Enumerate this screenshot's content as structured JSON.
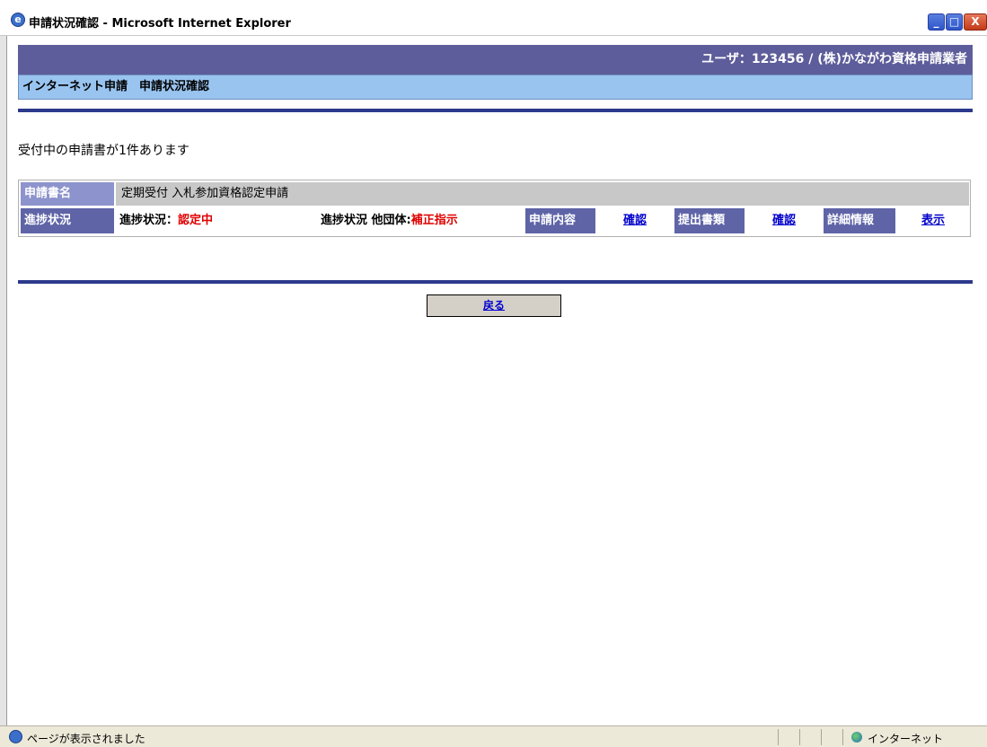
{
  "window": {
    "title": "申請状況確認 - Microsoft Internet Explorer",
    "minimize": "_",
    "maximize": "□",
    "close": "X"
  },
  "header": {
    "user_info": "ユーザ：123456 / (株)かながわ資格申請業者",
    "page_title": "インターネット申請　申請状況確認"
  },
  "main": {
    "notice": "受付中の申請書が1件あります",
    "application": {
      "name_label": "申請書名",
      "name_value": "定期受付 入札参加資格認定申請",
      "status_label": "進捗状況",
      "status_prefix": "進捗状況：",
      "status_value": "認定中",
      "other_status_prefix": "進捗状況 他団体:",
      "other_status_value": "補正指示",
      "content_label": "申請内容",
      "content_link": "確認",
      "docs_label": "提出書類",
      "docs_link": "確認",
      "detail_label": "詳細情報",
      "detail_link": "表示"
    },
    "back_button": "戻る"
  },
  "statusbar": {
    "message": "ページが表示されました",
    "zone": "インターネット"
  }
}
